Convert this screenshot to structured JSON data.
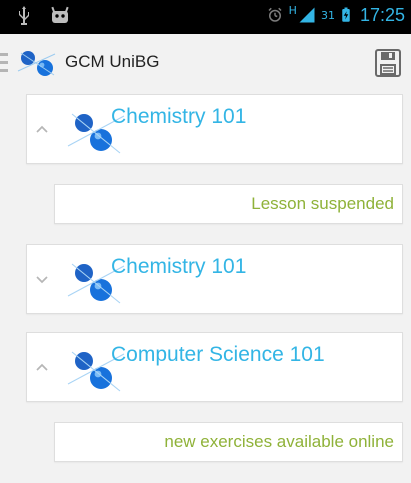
{
  "status_bar": {
    "time": "17:25",
    "signal_type": "H",
    "battery_level": "31"
  },
  "action_bar": {
    "title": "GCM UniBG",
    "icons": {
      "logo": "molecule-logo-icon",
      "save": "save-icon",
      "drawer": "drawer-indicator-icon"
    }
  },
  "courses": [
    {
      "title": "Chemistry 101",
      "expanded": true,
      "note": "Lesson suspended"
    },
    {
      "title": "Chemistry 101",
      "expanded": false
    },
    {
      "title": "Computer Science 101",
      "expanded": true,
      "note": "new exercises available online"
    }
  ],
  "colors": {
    "accent": "#33b5e5",
    "note": "#8fb239",
    "status_bar": "#000000",
    "background": "#f2f2f2"
  }
}
